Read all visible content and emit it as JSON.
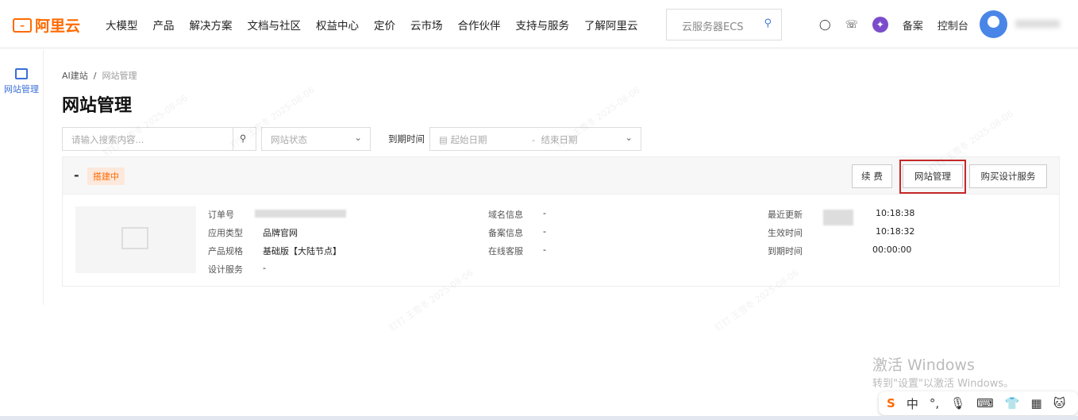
{
  "header": {
    "logo": "阿里云",
    "nav": [
      "大模型",
      "产品",
      "解决方案",
      "文档与社区",
      "权益中心",
      "定价",
      "云市场",
      "合作伙伴",
      "支持与服务",
      "了解阿里云"
    ],
    "search_placeholder": "云服务器ECS",
    "links": [
      "备案",
      "控制台"
    ]
  },
  "sidebar": {
    "items": [
      {
        "label": "网站管理",
        "icon": "monitor-icon",
        "active": true
      }
    ]
  },
  "breadcrumb": [
    "AI建站",
    "网站管理"
  ],
  "page_title": "网站管理",
  "filters": {
    "search_placeholder": "请输入搜索内容...",
    "status_placeholder": "网站状态",
    "expire_label": "到期时间",
    "start_placeholder": "起始日期",
    "end_placeholder": "结束日期"
  },
  "card": {
    "name": "-",
    "status": "搭建中",
    "buttons": [
      "续 费",
      "网站管理",
      "购买设计服务"
    ],
    "col1": [
      {
        "label": "订单号",
        "value": ""
      },
      {
        "label": "应用类型",
        "value": "品牌官网"
      },
      {
        "label": "产品规格",
        "value": "基础版【大陆节点】"
      },
      {
        "label": "设计服务",
        "value": "-"
      }
    ],
    "col2": [
      {
        "label": "域名信息",
        "value": "-"
      },
      {
        "label": "备案信息",
        "value": "-"
      },
      {
        "label": "在线客服",
        "value": "-"
      }
    ],
    "col3": [
      {
        "label": "最近更新",
        "value": "10:18:38"
      },
      {
        "label": "生效时间",
        "value": "10:18:32"
      },
      {
        "label": "到期时间",
        "value": "00:00:00"
      }
    ]
  },
  "watermark": "钉钉 王雪冬 2025-08-06",
  "windows": {
    "line1": "激活 Windows",
    "line2": "转到\"设置\"以激活 Windows。"
  },
  "tray": [
    "S",
    "中",
    "°,",
    "🎙",
    "⌨",
    "👕",
    "▦",
    "🐱"
  ],
  "colors": {
    "brand": "#ff6a00",
    "accent": "#3a6fd8",
    "highlight": "#c62828"
  }
}
